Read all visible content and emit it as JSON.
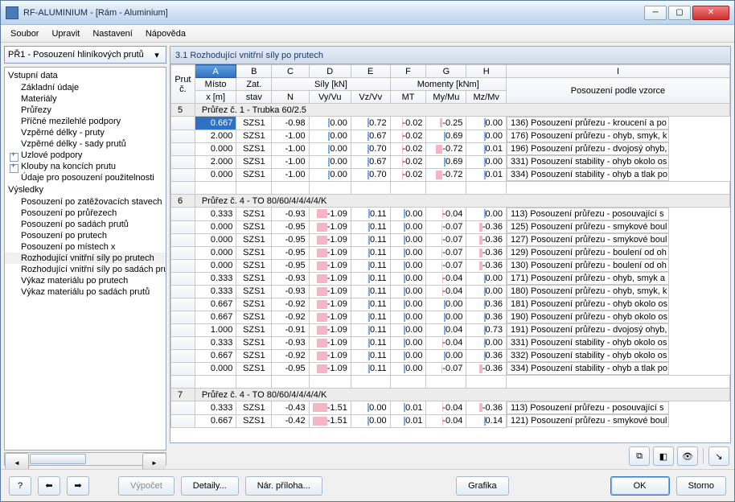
{
  "window": {
    "title": "RF-ALUMINIUM - [Rám - Aluminium]"
  },
  "menu": [
    "Soubor",
    "Upravit",
    "Nastavení",
    "Nápověda"
  ],
  "combo": {
    "text": "PŘ1 - Posouzení hliníkových prutů"
  },
  "tree": {
    "input_header": "Vstupní data",
    "input": [
      {
        "label": "Základní údaje",
        "exp": false
      },
      {
        "label": "Materiály",
        "exp": false
      },
      {
        "label": "Průřezy",
        "exp": false
      },
      {
        "label": "Příčné mezilehlé podpory",
        "exp": false
      },
      {
        "label": "Vzpěrné délky - pruty",
        "exp": false
      },
      {
        "label": "Vzpěrné délky - sady prutů",
        "exp": false
      },
      {
        "label": "Uzlové podpory",
        "exp": true
      },
      {
        "label": "Klouby na koncích prutu",
        "exp": true
      },
      {
        "label": "Údaje pro posouzení použitelnosti",
        "exp": false
      }
    ],
    "results_header": "Výsledky",
    "results": [
      {
        "label": "Posouzení po zatěžovacích stavech"
      },
      {
        "label": "Posouzení po průřezech"
      },
      {
        "label": "Posouzení po sadách prutů"
      },
      {
        "label": "Posouzení po prutech"
      },
      {
        "label": "Posouzení po místech x"
      },
      {
        "label": "Rozhodující vnitřní síly po prutech",
        "sel": true
      },
      {
        "label": "Rozhodující vnitřní síly po sadách prutů"
      },
      {
        "label": "Výkaz materiálu po prutech"
      },
      {
        "label": "Výkaz materiálu po sadách prutů"
      }
    ]
  },
  "pane": {
    "title": "3.1 Rozhodující vnitřní síly po prutech"
  },
  "columns": {
    "letters": [
      "A",
      "B",
      "C",
      "D",
      "E",
      "F",
      "G",
      "H",
      "I"
    ],
    "prut": "Prut",
    "c": "č.",
    "misto": "Místo",
    "x": "x [m]",
    "zat": "Zat.",
    "stav": "stav",
    "sily": "Síly [kN]",
    "N": "N",
    "VyVu": "Vy/Vu",
    "VzVv": "Vz/Vv",
    "momenty": "Momenty [kNm]",
    "MT": "MT",
    "MyMu": "My/Mu",
    "MzMv": "Mz/Mv",
    "vzorce": "Posouzení podle vzorce"
  },
  "groups": [
    {
      "prut": "5",
      "title": "Průřez č.  1 - Trubka 60/2.5",
      "rows": [
        {
          "x": "0.667",
          "stav": "SZS1",
          "N": "-0.98",
          "Vy": "0.00",
          "Vz": "0.72",
          "MT": "-0.02",
          "My": "-0.25",
          "Mz": "0.00",
          "desc": "136) Posouzení průřezu - kroucení a po",
          "cur": true
        },
        {
          "x": "2.000",
          "stav": "SZS1",
          "N": "-1.00",
          "Vy": "0.00",
          "Vz": "0.67",
          "MT": "-0.02",
          "My": "0.69",
          "Mz": "0.00",
          "desc": "176) Posouzení průřezu - ohyb, smyk, k"
        },
        {
          "x": "0.000",
          "stav": "SZS1",
          "N": "-1.00",
          "Vy": "0.00",
          "Vz": "0.70",
          "MT": "-0.02",
          "My": "-0.72",
          "Mz": "0.01",
          "desc": "196) Posouzení průřezu - dvojosý ohyb,"
        },
        {
          "x": "2.000",
          "stav": "SZS1",
          "N": "-1.00",
          "Vy": "0.00",
          "Vz": "0.67",
          "MT": "-0.02",
          "My": "0.69",
          "Mz": "0.00",
          "desc": "331) Posouzení stability - ohyb okolo os"
        },
        {
          "x": "0.000",
          "stav": "SZS1",
          "N": "-1.00",
          "Vy": "0.00",
          "Vz": "0.70",
          "MT": "-0.02",
          "My": "-0.72",
          "Mz": "0.01",
          "desc": "334) Posouzení stability - ohyb a tlak po"
        }
      ]
    },
    {
      "prut": "6",
      "title": "Průřez č.  4 - TO 80/60/4/4/4/4/K",
      "rows": [
        {
          "x": "0.333",
          "stav": "SZS1",
          "N": "-0.93",
          "Vy": "-1.09",
          "Vz": "0.11",
          "MT": "0.00",
          "My": "-0.04",
          "Mz": "0.00",
          "desc": "113) Posouzení průřezu - posouvající s"
        },
        {
          "x": "0.000",
          "stav": "SZS1",
          "N": "-0.95",
          "Vy": "-1.09",
          "Vz": "0.11",
          "MT": "0.00",
          "My": "-0.07",
          "Mz": "-0.36",
          "desc": "125) Posouzení průřezu - smykové boul"
        },
        {
          "x": "0.000",
          "stav": "SZS1",
          "N": "-0.95",
          "Vy": "-1.09",
          "Vz": "0.11",
          "MT": "0.00",
          "My": "-0.07",
          "Mz": "-0.36",
          "desc": "127) Posouzení průřezu - smykové boul"
        },
        {
          "x": "0.000",
          "stav": "SZS1",
          "N": "-0.95",
          "Vy": "-1.09",
          "Vz": "0.11",
          "MT": "0.00",
          "My": "-0.07",
          "Mz": "-0.36",
          "desc": "129) Posouzení průřezu - boulení od oh"
        },
        {
          "x": "0.000",
          "stav": "SZS1",
          "N": "-0.95",
          "Vy": "-1.09",
          "Vz": "0.11",
          "MT": "0.00",
          "My": "-0.07",
          "Mz": "-0.36",
          "desc": "130) Posouzení průřezu - boulení od oh"
        },
        {
          "x": "0.333",
          "stav": "SZS1",
          "N": "-0.93",
          "Vy": "-1.09",
          "Vz": "0.11",
          "MT": "0.00",
          "My": "-0.04",
          "Mz": "0.00",
          "desc": "171) Posouzení průřezu - ohyb, smyk a"
        },
        {
          "x": "0.333",
          "stav": "SZS1",
          "N": "-0.93",
          "Vy": "-1.09",
          "Vz": "0.11",
          "MT": "0.00",
          "My": "-0.04",
          "Mz": "0.00",
          "desc": "180) Posouzení průřezu - ohyb, smyk, k"
        },
        {
          "x": "0.667",
          "stav": "SZS1",
          "N": "-0.92",
          "Vy": "-1.09",
          "Vz": "0.11",
          "MT": "0.00",
          "My": "0.00",
          "Mz": "0.36",
          "desc": "181) Posouzení průřezu - ohyb okolo os"
        },
        {
          "x": "0.667",
          "stav": "SZS1",
          "N": "-0.92",
          "Vy": "-1.09",
          "Vz": "0.11",
          "MT": "0.00",
          "My": "0.00",
          "Mz": "0.36",
          "desc": "190) Posouzení průřezu - ohyb okolo os"
        },
        {
          "x": "1.000",
          "stav": "SZS1",
          "N": "-0.91",
          "Vy": "-1.09",
          "Vz": "0.11",
          "MT": "0.00",
          "My": "0.04",
          "Mz": "0.73",
          "desc": "191) Posouzení průřezu - dvojosý ohyb,"
        },
        {
          "x": "0.333",
          "stav": "SZS1",
          "N": "-0.93",
          "Vy": "-1.09",
          "Vz": "0.11",
          "MT": "0.00",
          "My": "-0.04",
          "Mz": "0.00",
          "desc": "331) Posouzení stability - ohyb okolo os"
        },
        {
          "x": "0.667",
          "stav": "SZS1",
          "N": "-0.92",
          "Vy": "-1.09",
          "Vz": "0.11",
          "MT": "0.00",
          "My": "0.00",
          "Mz": "0.36",
          "desc": "332) Posouzení stability - ohyb okolo os"
        },
        {
          "x": "0.000",
          "stav": "SZS1",
          "N": "-0.95",
          "Vy": "-1.09",
          "Vz": "0.11",
          "MT": "0.00",
          "My": "-0.07",
          "Mz": "-0.36",
          "desc": "334) Posouzení stability - ohyb a tlak po"
        }
      ]
    },
    {
      "prut": "7",
      "title": "Průřez č.  4 - TO 80/60/4/4/4/4/K",
      "rows": [
        {
          "x": "0.333",
          "stav": "SZS1",
          "N": "-0.43",
          "Vy": "-1.51",
          "Vz": "0.00",
          "MT": "0.01",
          "My": "-0.04",
          "Mz": "-0.36",
          "desc": "113) Posouzení průřezu - posouvající s"
        },
        {
          "x": "0.667",
          "stav": "SZS1",
          "N": "-0.42",
          "Vy": "-1.51",
          "Vz": "0.00",
          "MT": "0.01",
          "My": "-0.04",
          "Mz": "0.14",
          "desc": "121) Posouzení průřezu - smykové boul"
        }
      ]
    }
  ],
  "toolbar_icons": [
    "filter-icon",
    "color-icon",
    "eye-icon",
    "divider",
    "pick-icon"
  ],
  "footer": {
    "help": "?",
    "prev": "◄",
    "next": "►",
    "vypocet": "Výpočet",
    "detaily": "Detaily...",
    "priloha": "Nár. příloha...",
    "grafika": "Grafika",
    "ok": "OK",
    "storno": "Storno"
  }
}
